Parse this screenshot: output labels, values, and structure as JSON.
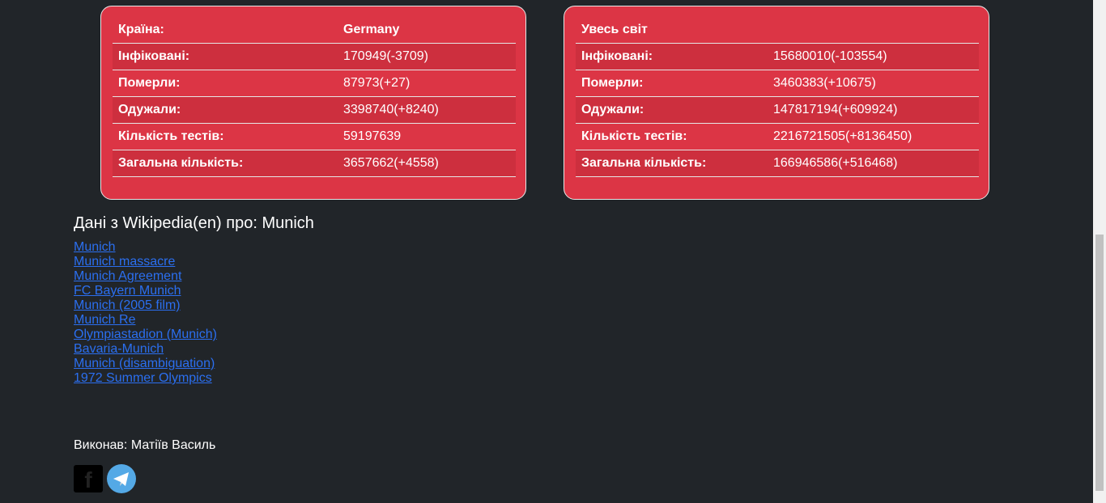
{
  "country": {
    "header": [
      "Країна:",
      "Germany"
    ],
    "rows": [
      [
        "Інфіковані:",
        "170949(-3709)"
      ],
      [
        "Померли:",
        "87973(+27)"
      ],
      [
        "Одужали:",
        "3398740(+8240)"
      ],
      [
        "Кількість тестів:",
        "59197639"
      ],
      [
        "Загальна кількість:",
        "3657662(+4558)"
      ]
    ]
  },
  "world": {
    "header": [
      "Увесь світ",
      ""
    ],
    "rows": [
      [
        "Інфіковані:",
        "15680010(-103554)"
      ],
      [
        "Померли:",
        "3460383(+10675)"
      ],
      [
        "Одужали:",
        "147817194(+609924)"
      ],
      [
        "Кількість тестів:",
        "2216721505(+8136450)"
      ],
      [
        "Загальна кількість:",
        "166946586(+516468)"
      ]
    ]
  },
  "wiki": {
    "title": "Дані з Wikipedia(en) про: Munich",
    "links": [
      "Munich",
      "Munich massacre",
      "Munich Agreement",
      "FC Bayern Munich",
      "Munich (2005 film)",
      "Munich Re",
      "Olympiastadion (Munich)",
      "Bavaria-Munich",
      "Munich (disambiguation)",
      "1972 Summer Olympics"
    ]
  },
  "footer": {
    "author": "Виконав: Матіїв Василь",
    "facebook_glyph": "f"
  }
}
